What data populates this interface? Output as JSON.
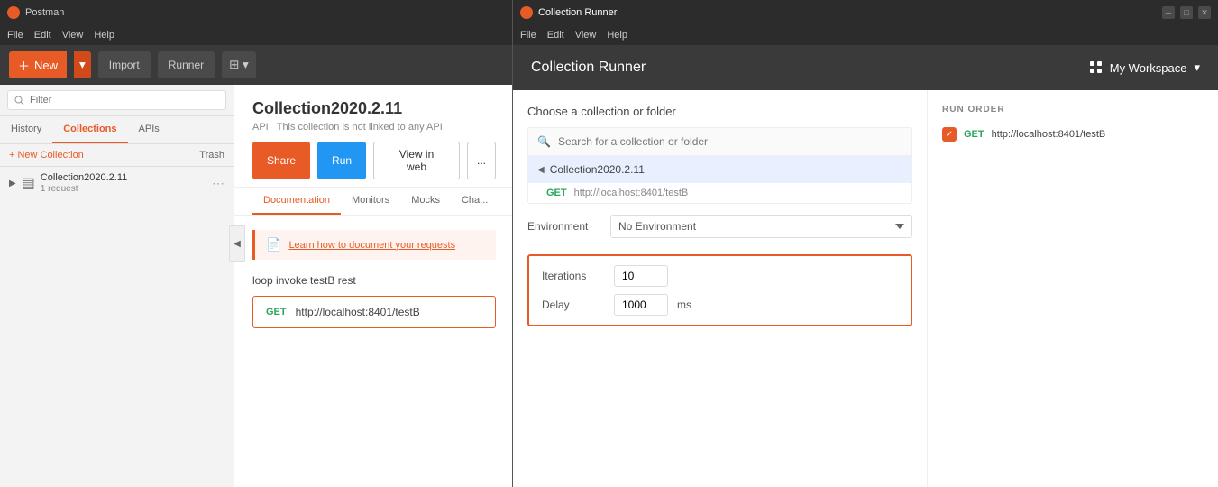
{
  "postman": {
    "title": "Postman",
    "app_name": "Postman",
    "menu": {
      "file": "File",
      "edit": "Edit",
      "view": "View",
      "help": "Help"
    },
    "toolbar": {
      "new_label": "New",
      "import_label": "Import",
      "runner_label": "Runner"
    },
    "sidebar": {
      "search_placeholder": "Filter",
      "tabs": [
        {
          "id": "history",
          "label": "History"
        },
        {
          "id": "collections",
          "label": "Collections",
          "active": true
        },
        {
          "id": "apis",
          "label": "APIs"
        }
      ],
      "new_collection_label": "New Collection",
      "trash_label": "Trash",
      "collections": [
        {
          "name": "Collection2020.2.11",
          "sub": "1 request"
        }
      ]
    },
    "detail": {
      "title": "Collection2020.2.11",
      "api_label": "API",
      "api_info": "This collection is not linked to any API",
      "share_label": "Share",
      "run_label": "Run",
      "view_web_label": "View in web",
      "more_label": "...",
      "tabs": [
        {
          "label": "Documentation",
          "active": true
        },
        {
          "label": "Monitors"
        },
        {
          "label": "Mocks"
        },
        {
          "label": "Cha..."
        }
      ],
      "doc_banner_text": "Learn how to document your requests",
      "request_name": "loop invoke testB rest",
      "request_method": "GET",
      "request_url": "http://localhost:8401/testB"
    }
  },
  "runner": {
    "title": "Collection Runner",
    "window_title": "Collection Runner",
    "menu": {
      "file": "File",
      "edit": "Edit",
      "view": "View",
      "help": "Help"
    },
    "header_title": "Collection Runner",
    "workspace_label": "My Workspace",
    "choose_section_title": "Choose a collection or folder",
    "search_placeholder": "Search for a collection or folder",
    "collection_name": "Collection2020.2.11",
    "get_method": "GET",
    "get_url": "http://localhost:8401/testB",
    "environment_label": "Environment",
    "environment_value": "No Environment",
    "environment_options": [
      "No Environment"
    ],
    "iterations_label": "Iterations",
    "iterations_value": "10",
    "delay_label": "Delay",
    "delay_value": "1000",
    "delay_unit": "ms",
    "run_order": {
      "title": "RUN ORDER",
      "items": [
        {
          "method": "GET",
          "url": "http://localhost:8401/testB",
          "checked": true
        }
      ]
    }
  }
}
